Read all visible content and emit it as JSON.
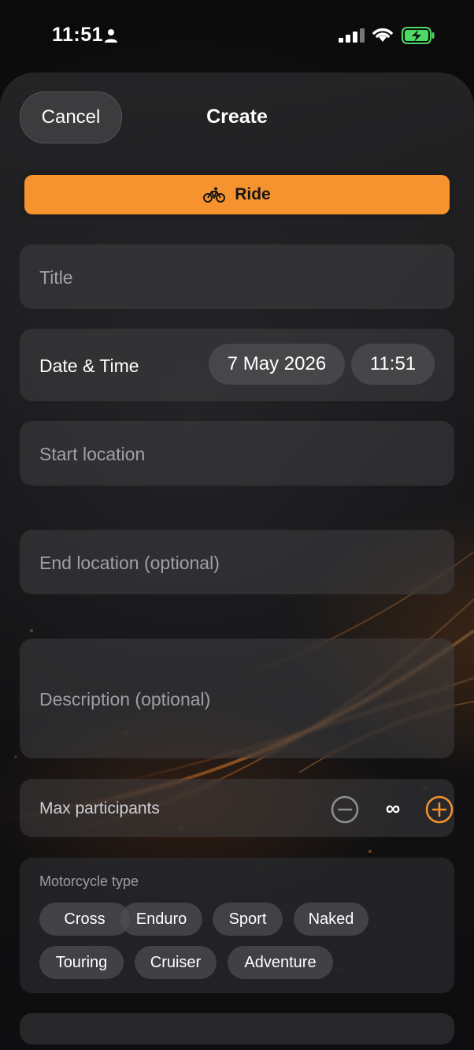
{
  "status_bar": {
    "time": "11:51"
  },
  "header": {
    "cancel_label": "Cancel",
    "title": "Create"
  },
  "type_selector": {
    "selected_label": "Ride",
    "icon": "bicycle-icon",
    "accent": "#f7932e"
  },
  "form": {
    "title_placeholder": "Title",
    "datetime": {
      "label": "Date & Time",
      "date": "7 May 2026",
      "time": "11:51"
    },
    "start_location_placeholder": "Start location",
    "end_location_placeholder": "End location (optional)",
    "description_placeholder": "Description (optional)",
    "max_participants": {
      "label": "Max participants",
      "value": "∞"
    },
    "motorcycle_type": {
      "label": "Motorcycle type",
      "chips": [
        "Cross",
        "Enduro",
        "Sport",
        "Naked",
        "Touring",
        "Cruiser",
        "Adventure"
      ]
    }
  }
}
